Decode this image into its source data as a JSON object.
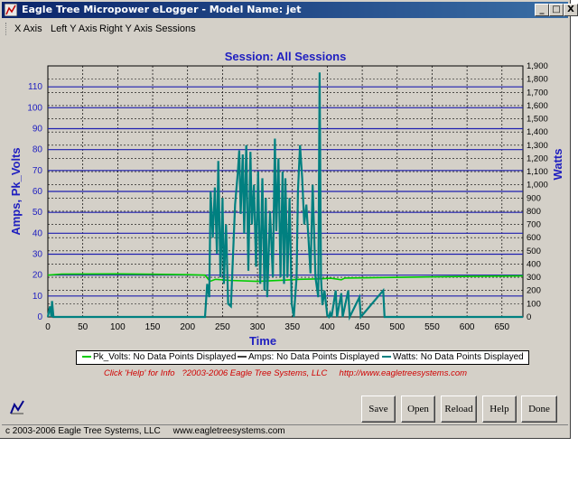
{
  "window": {
    "title": "Eagle Tree Micropower eLogger - Model Name: jet",
    "buttons": [
      "_",
      "□",
      "X"
    ]
  },
  "menu": [
    "X Axis",
    "Left Y Axis",
    "Right Y Axis",
    "Sessions"
  ],
  "chart_data": {
    "type": "line",
    "title": "Session: All Sessions",
    "xlabel": "Time",
    "ylabel_left": "Amps, Pk_Volts",
    "ylabel_right": "Watts",
    "xlim": [
      0,
      680
    ],
    "ylim_left": [
      0,
      120
    ],
    "ylim_right": [
      0,
      1900
    ],
    "x_ticks": [
      0,
      50,
      100,
      150,
      200,
      250,
      300,
      350,
      400,
      450,
      500,
      550,
      600,
      650
    ],
    "y_left_ticks": [
      0,
      10,
      20,
      30,
      40,
      50,
      60,
      70,
      80,
      90,
      100,
      110
    ],
    "y_right_ticks": [
      "0",
      "100",
      "200",
      "300",
      "400",
      "500",
      "600",
      "700",
      "800",
      "900",
      "1,000",
      "1,100",
      "1,200",
      "1,300",
      "1,400",
      "1,500",
      "1,600",
      "1,700",
      "1,800",
      "1,900"
    ],
    "grid": true,
    "legend_position": "bottom",
    "colors": {
      "background": "#d4d0c8",
      "axis_text": "#2020c0",
      "pk_volts": "#00cc00",
      "amps": "#404040",
      "watts": "#008080"
    },
    "series": [
      {
        "name": "Pk_Volts",
        "axis": "left",
        "points": [
          [
            0,
            20
          ],
          [
            20,
            20.5
          ],
          [
            100,
            20.6
          ],
          [
            150,
            20.4
          ],
          [
            200,
            20.2
          ],
          [
            225,
            20
          ],
          [
            232,
            17
          ],
          [
            240,
            18
          ],
          [
            260,
            17.5
          ],
          [
            300,
            17
          ],
          [
            340,
            17.6
          ],
          [
            360,
            18
          ],
          [
            390,
            18.2
          ],
          [
            405,
            18.5
          ],
          [
            420,
            17.8
          ],
          [
            425,
            18.6
          ],
          [
            600,
            19.4
          ],
          [
            680,
            19.6
          ]
        ]
      },
      {
        "name": "Watts",
        "axis": "right",
        "points": [
          [
            0,
            0
          ],
          [
            3,
            80
          ],
          [
            5,
            0
          ],
          [
            6,
            120
          ],
          [
            8,
            0
          ],
          [
            225,
            0
          ],
          [
            228,
            250
          ],
          [
            231,
            150
          ],
          [
            233,
            950
          ],
          [
            236,
            600
          ],
          [
            239,
            980
          ],
          [
            242,
            480
          ],
          [
            244,
            1180
          ],
          [
            247,
            300
          ],
          [
            250,
            900
          ],
          [
            252,
            250
          ],
          [
            255,
            700
          ],
          [
            258,
            100
          ],
          [
            262,
            80
          ],
          [
            268,
            850
          ],
          [
            272,
            1100
          ],
          [
            274,
            1260
          ],
          [
            276,
            780
          ],
          [
            279,
            1230
          ],
          [
            281,
            630
          ],
          [
            284,
            1300
          ],
          [
            287,
            350
          ],
          [
            290,
            1250
          ],
          [
            292,
            700
          ],
          [
            295,
            1000
          ],
          [
            298,
            380
          ],
          [
            301,
            1100
          ],
          [
            304,
            250
          ],
          [
            307,
            1050
          ],
          [
            310,
            200
          ],
          [
            312,
            900
          ],
          [
            314,
            150
          ],
          [
            318,
            800
          ],
          [
            322,
            300
          ],
          [
            325,
            1350
          ],
          [
            327,
            650
          ],
          [
            330,
            1200
          ],
          [
            333,
            300
          ],
          [
            336,
            1100
          ],
          [
            338,
            250
          ],
          [
            340,
            1050
          ],
          [
            343,
            300
          ],
          [
            346,
            900
          ],
          [
            349,
            100
          ],
          [
            352,
            0
          ],
          [
            356,
            300
          ],
          [
            358,
            950
          ],
          [
            361,
            1300
          ],
          [
            364,
            1050
          ],
          [
            367,
            700
          ],
          [
            370,
            850
          ],
          [
            373,
            600
          ],
          [
            376,
            330
          ],
          [
            379,
            1000
          ],
          [
            383,
            300
          ],
          [
            387,
            150
          ],
          [
            389,
            1850
          ],
          [
            391,
            300
          ],
          [
            393,
            90
          ],
          [
            396,
            200
          ],
          [
            400,
            10
          ],
          [
            402,
            0
          ],
          [
            404,
            30
          ],
          [
            406,
            0
          ],
          [
            412,
            200
          ],
          [
            414,
            0
          ],
          [
            420,
            180
          ],
          [
            422,
            0
          ],
          [
            430,
            200
          ],
          [
            432,
            0
          ],
          [
            446,
            150
          ],
          [
            448,
            0
          ],
          [
            480,
            200
          ],
          [
            482,
            0
          ],
          [
            680,
            0
          ]
        ]
      }
    ],
    "legend": [
      {
        "label": "Pk_Volts: No Data Points Displayed"
      },
      {
        "label": "Amps: No Data Points Displayed"
      },
      {
        "label": "Watts: No Data Points Displayed"
      }
    ]
  },
  "credits": "Click 'Help' for Info   ?2003-2006 Eagle Tree Systems, LLC     http://www.eagletreesystems.com",
  "buttons": [
    "Save",
    "Open",
    "Reload",
    "Help",
    "Done"
  ],
  "status": "c 2003-2006 Eagle Tree Systems, LLC     www.eagletreesystems.com"
}
